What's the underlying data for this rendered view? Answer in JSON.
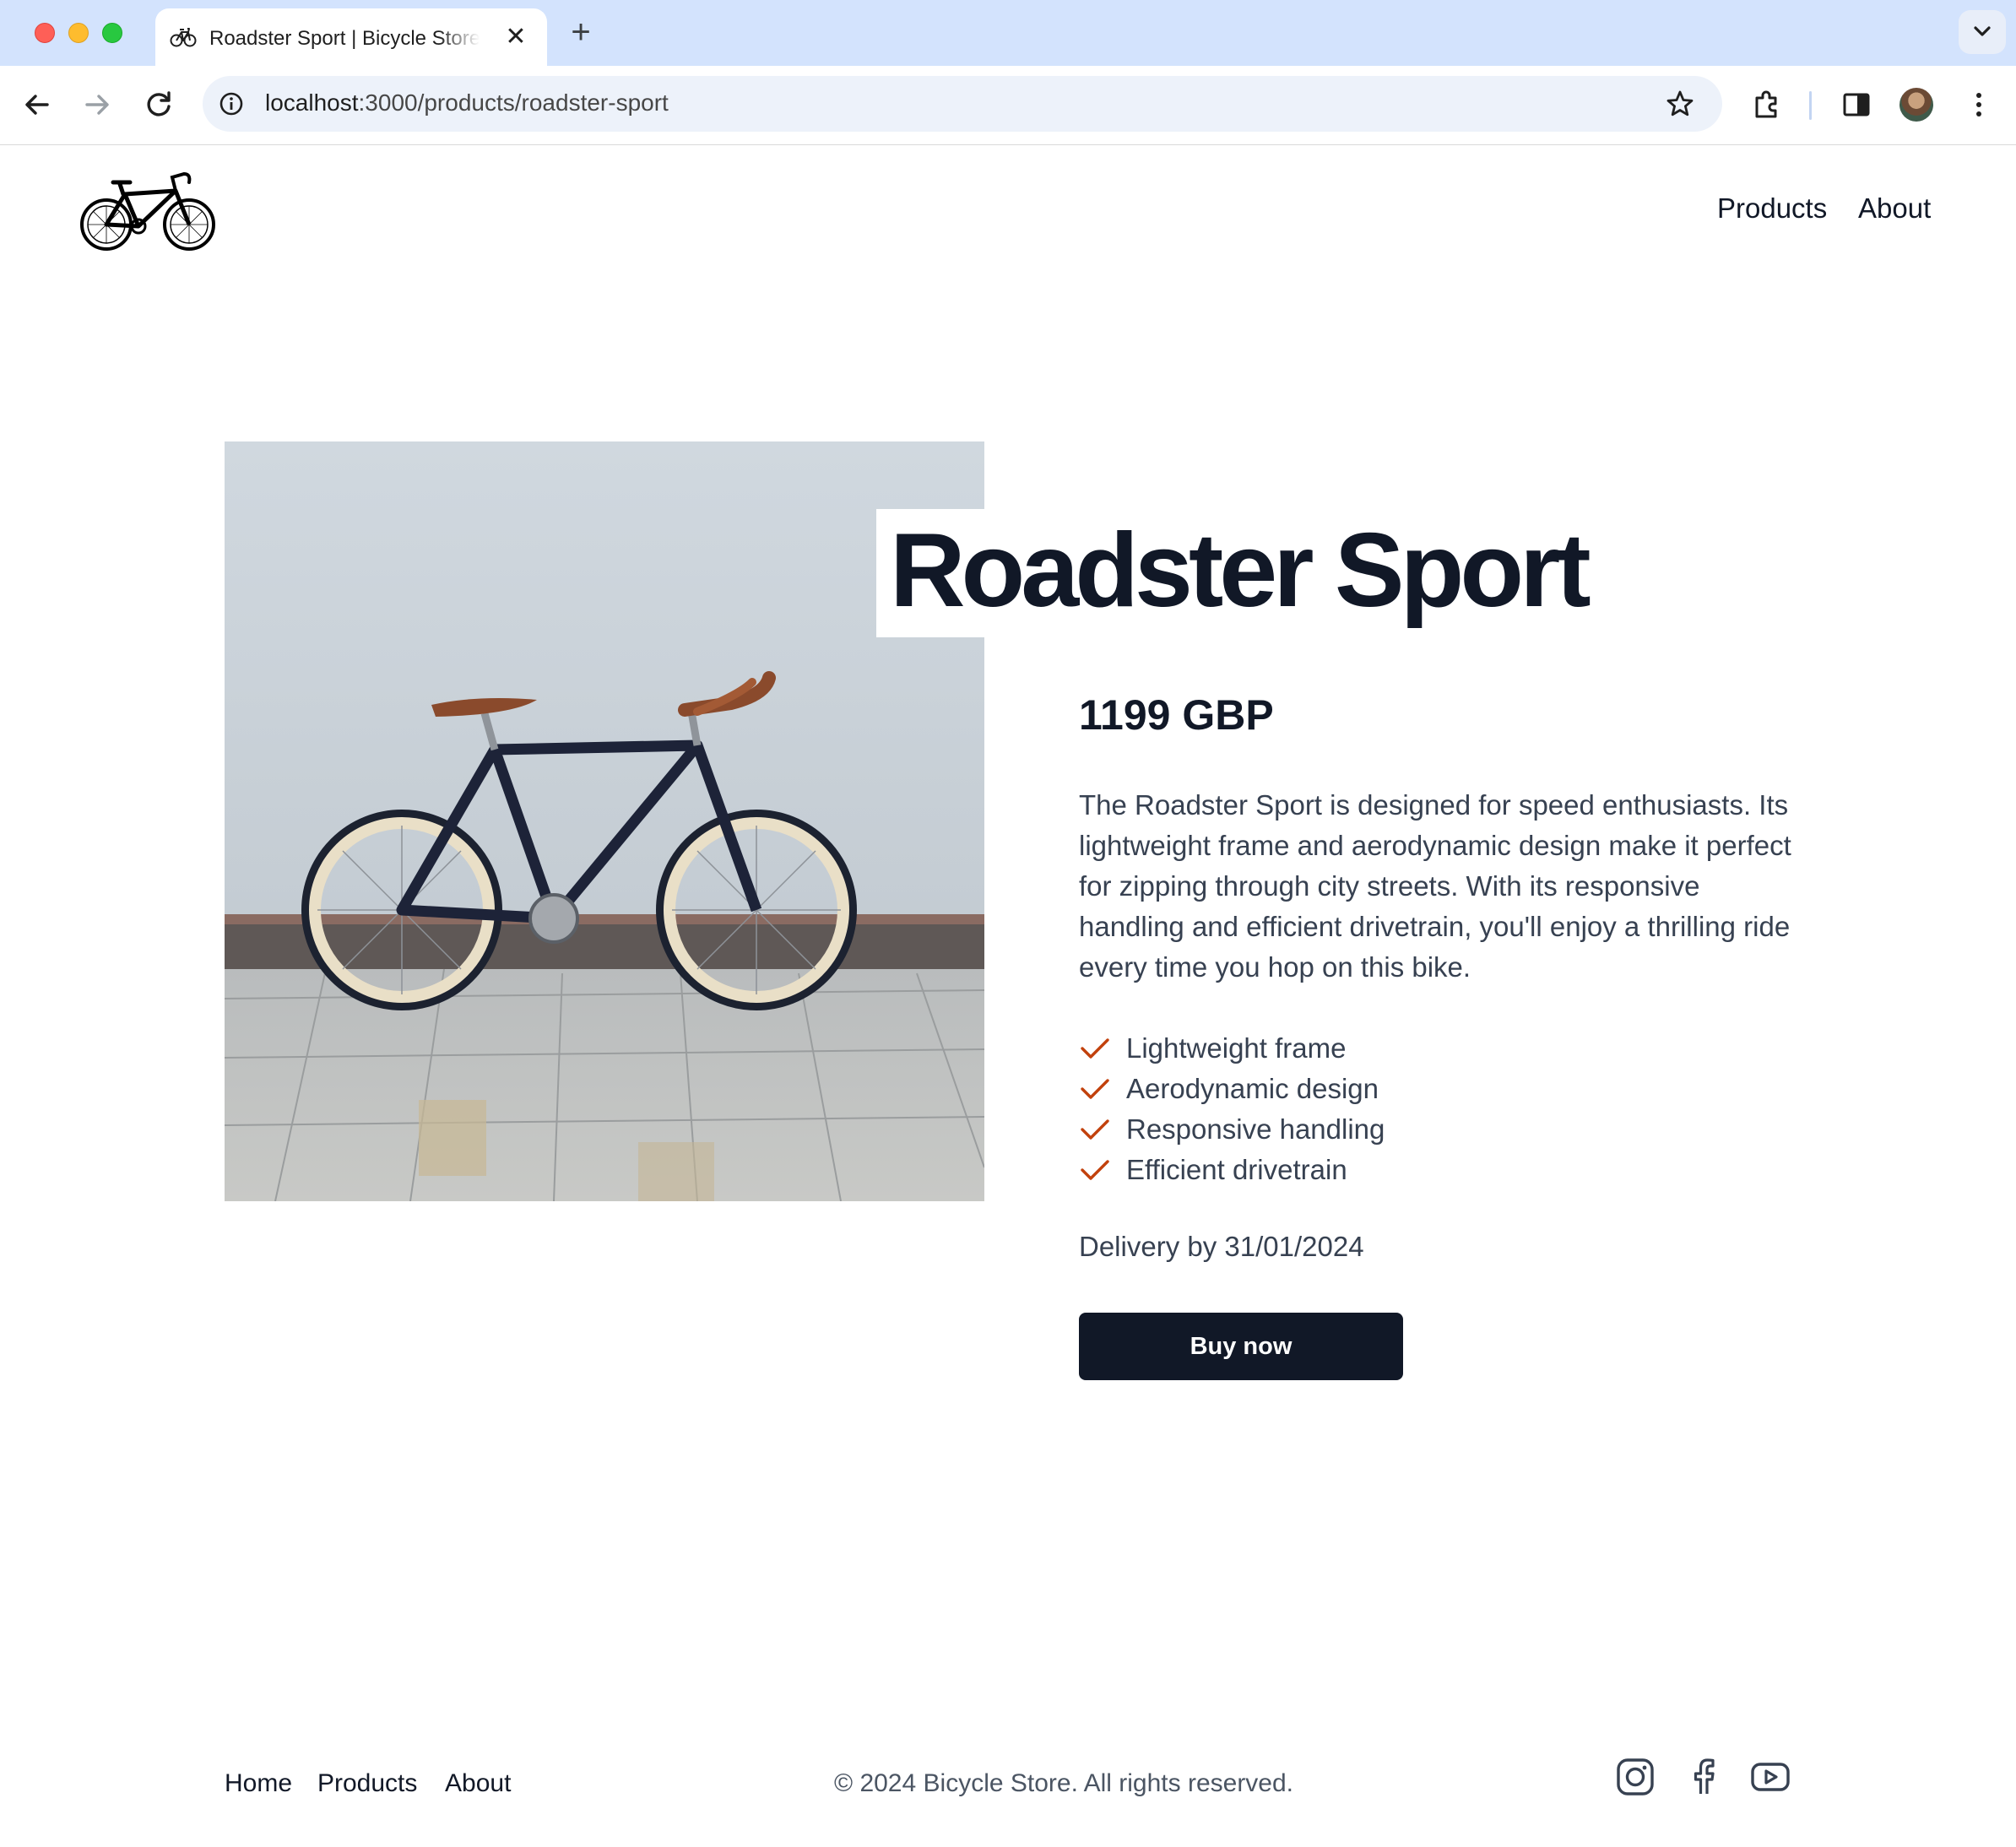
{
  "browser": {
    "tab": {
      "title": "Roadster Sport | Bicycle Store",
      "close_icon": "close-icon",
      "favicon": "bicycle-icon"
    },
    "new_tab_label": "+",
    "address": {
      "host": "localhost",
      "path": ":3000/products/roadster-sport"
    },
    "icons": [
      "back-arrow-icon",
      "forward-arrow-icon",
      "reload-icon",
      "site-info-icon",
      "star-icon",
      "extensions-icon",
      "side-panel-icon",
      "profile-avatar",
      "more-vertical-icon",
      "tab-search-chevron-icon"
    ]
  },
  "site": {
    "logo": "bicycle-logo",
    "nav": {
      "products": "Products",
      "about": "About"
    }
  },
  "product": {
    "title": "Roadster Sport",
    "price": "1199 GBP",
    "description": "The Roadster Sport is designed for speed enthusiasts. Its lightweight frame and aerodynamic design make it perfect for zipping through city streets. With its responsive handling and efficient drivetrain, you'll enjoy a thrilling ride every time you hop on this bike.",
    "features": [
      "Lightweight frame",
      "Aerodynamic design",
      "Responsive handling",
      "Efficient drivetrain"
    ],
    "delivery": "Delivery by 31/01/2024",
    "buy_label": "Buy now",
    "check_color": "#c2410c",
    "image": "bicycle-photo"
  },
  "footer": {
    "links": {
      "home": "Home",
      "products": "Products",
      "about": "About"
    },
    "copyright": "© 2024 Bicycle Store. All rights reserved.",
    "social_icons": [
      "instagram-icon",
      "facebook-icon",
      "youtube-icon"
    ]
  },
  "colors": {
    "primary": "#111827",
    "body_text": "#374151",
    "accent": "#c2410c",
    "tabbar": "#d3e3fd"
  }
}
